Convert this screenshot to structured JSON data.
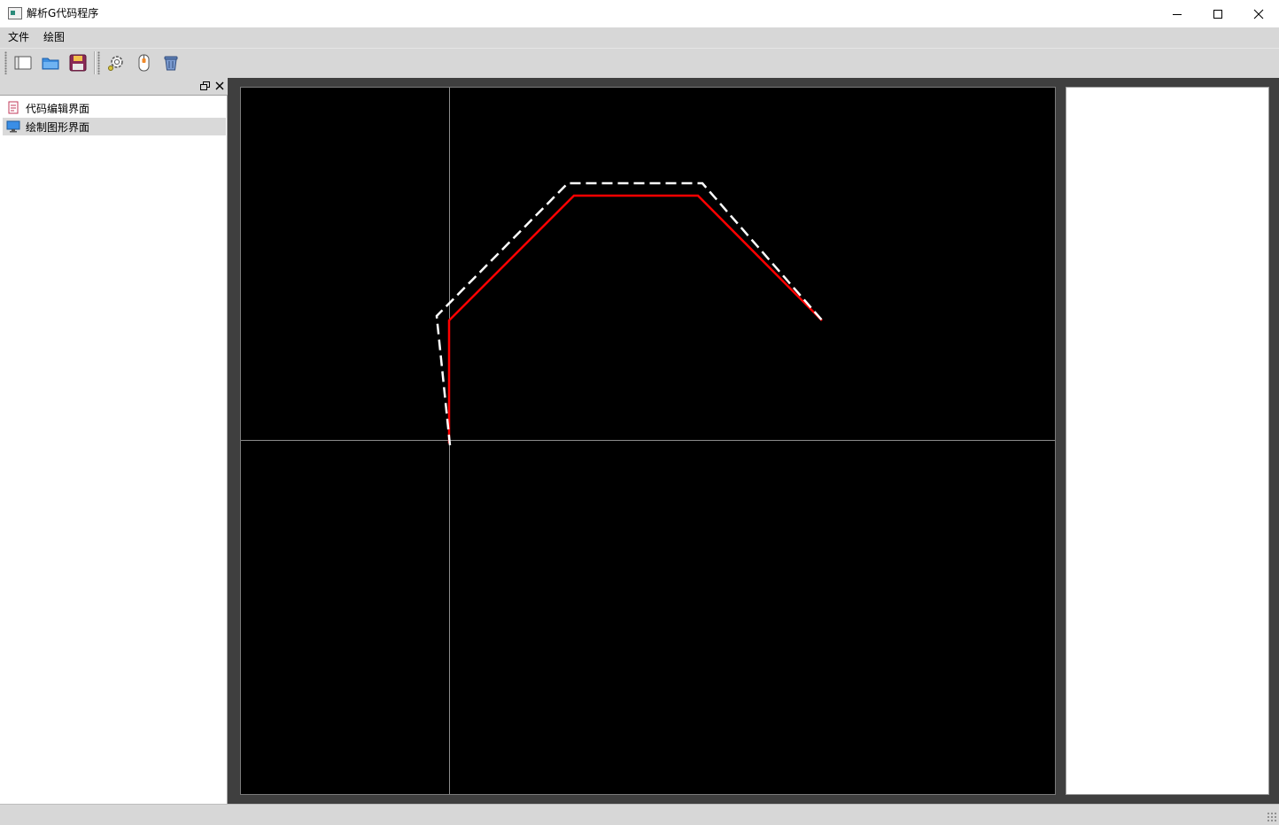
{
  "window": {
    "title": "解析G代码程序",
    "buttons": [
      "minimize",
      "maximize",
      "close"
    ]
  },
  "menubar": {
    "items": [
      {
        "label": "文件"
      },
      {
        "label": "绘图"
      }
    ]
  },
  "toolbar": {
    "group1": [
      {
        "icon": "new-file-icon"
      },
      {
        "icon": "open-folder-icon"
      },
      {
        "icon": "save-disk-icon"
      }
    ],
    "group2": [
      {
        "icon": "settings-gear-icon"
      },
      {
        "icon": "mouse-icon"
      },
      {
        "icon": "trash-icon"
      }
    ]
  },
  "dock": {
    "items": [
      {
        "label": "代码编辑界面",
        "icon": "document-icon",
        "selected": false
      },
      {
        "label": "绘制图形界面",
        "icon": "monitor-icon",
        "selected": true
      }
    ]
  },
  "colors": {
    "canvas_bg": "#000000",
    "tool_path": "#ff0000",
    "offset_path": "#ffffff",
    "axis": "#8c8c8c",
    "workspace": "#3f3f3f",
    "chrome": "#d7d7d7"
  },
  "canvas": {
    "axes": "crosshair",
    "tool_path_style": "solid",
    "offset_path_style": "dashed"
  }
}
